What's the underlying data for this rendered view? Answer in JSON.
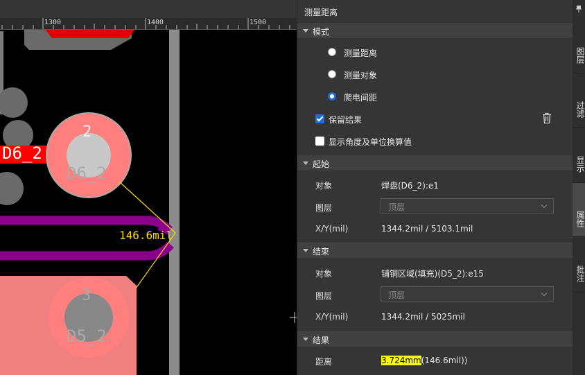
{
  "canvas": {
    "ruler_labels": [
      "1300",
      "1400",
      "1500"
    ],
    "pad_top_number": "2",
    "pad_top_net": "D6_2",
    "pad_bottom_number": "3",
    "pad_bottom_net": "D5_2",
    "net_label": "D6_2",
    "measure_label": "146.6mil"
  },
  "panel": {
    "title": "测量距离",
    "mode": {
      "header": "模式",
      "options": [
        {
          "label": "测量距离",
          "selected": false
        },
        {
          "label": "测量对象",
          "selected": false
        },
        {
          "label": "爬电间距",
          "selected": true
        }
      ],
      "keep_result": {
        "label": "保留结果",
        "checked": true
      },
      "show_angle": {
        "label": "显示角度及单位换算值",
        "checked": false
      },
      "trash_icon": "trash-icon"
    },
    "start": {
      "header": "起始",
      "object_label": "对象",
      "object_value": "焊盘(D6_2):e1",
      "layer_label": "图层",
      "layer_value": "顶层",
      "xy_label": "X/Y(mil)",
      "xy_value": "1344.2mil / 5103.1mil"
    },
    "end": {
      "header": "结束",
      "object_label": "对象",
      "object_value": "铺铜区域(填充)(D5_2):e15",
      "layer_label": "图层",
      "layer_value": "顶层",
      "xy_label": "X/Y(mil)",
      "xy_value": "1344.2mil / 5025mil"
    },
    "result": {
      "header": "结果",
      "distance_label": "距离",
      "distance_highlight": "3.724mm",
      "distance_rest": "(146.6mil))"
    }
  },
  "side_tabs": [
    {
      "label": "图层",
      "active": false
    },
    {
      "label": "过滤",
      "active": false
    },
    {
      "label": "显示",
      "active": false
    },
    {
      "label": "属性",
      "active": true
    },
    {
      "label": "批注",
      "active": false
    }
  ],
  "colors": {
    "accent": "#1e6fd9",
    "pad": "#ff7f7f",
    "trace": "#8b008b",
    "measure": "#ffd700",
    "net_label_bg": "#ff0000",
    "highlight": "#ffff00"
  }
}
